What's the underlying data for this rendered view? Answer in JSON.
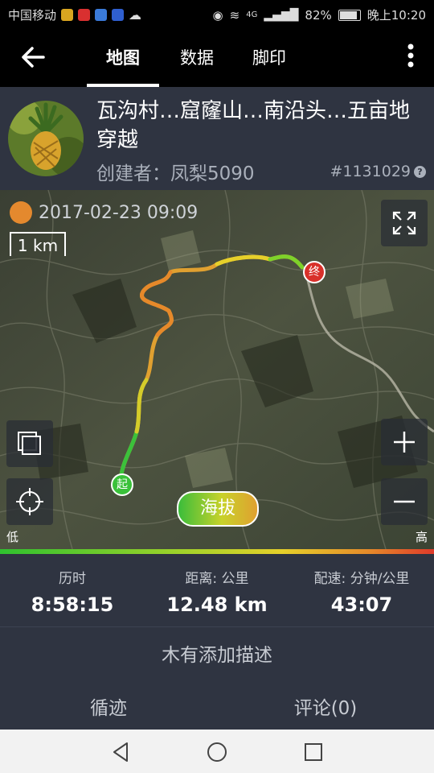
{
  "status_bar": {
    "carrier": "中国移动",
    "network": "4G",
    "battery": "82%",
    "time": "晚上10:20"
  },
  "toolbar": {
    "back_icon": "back-arrow-icon",
    "tabs": [
      {
        "label": "地图",
        "active": true
      },
      {
        "label": "数据",
        "active": false
      },
      {
        "label": "脚印",
        "active": false
      }
    ],
    "more_icon": "more-vertical-icon"
  },
  "track": {
    "title": "瓦沟村…窟窿山…南沿头…五亩地穿越",
    "creator": "创建者：凤梨5090",
    "track_id": "#1131029",
    "help_icon": "question-mark-icon"
  },
  "map": {
    "datetime": "2017-02-23 09:09",
    "scale_label": "1 km",
    "start_marker": "起",
    "end_marker": "终",
    "elevation_button": "海拔",
    "legend_low": "低",
    "legend_high": "高"
  },
  "stats": [
    {
      "label": "历时",
      "value": "8:58:15"
    },
    {
      "label": "距离: 公里",
      "value": "12.48 km"
    },
    {
      "label": "配速: 分钟/公里",
      "value": "43:07"
    }
  ],
  "description": "木有添加描述",
  "bottom_tabs": [
    {
      "label": "循迹"
    },
    {
      "label": "评论(0)"
    }
  ],
  "colors": {
    "panel": "#2f3441",
    "track_low": "#2fc12f",
    "track_mid": "#e6d02a",
    "track_high": "#e68a2a",
    "end_marker": "#d9302a",
    "start_marker": "#3ac13a"
  }
}
